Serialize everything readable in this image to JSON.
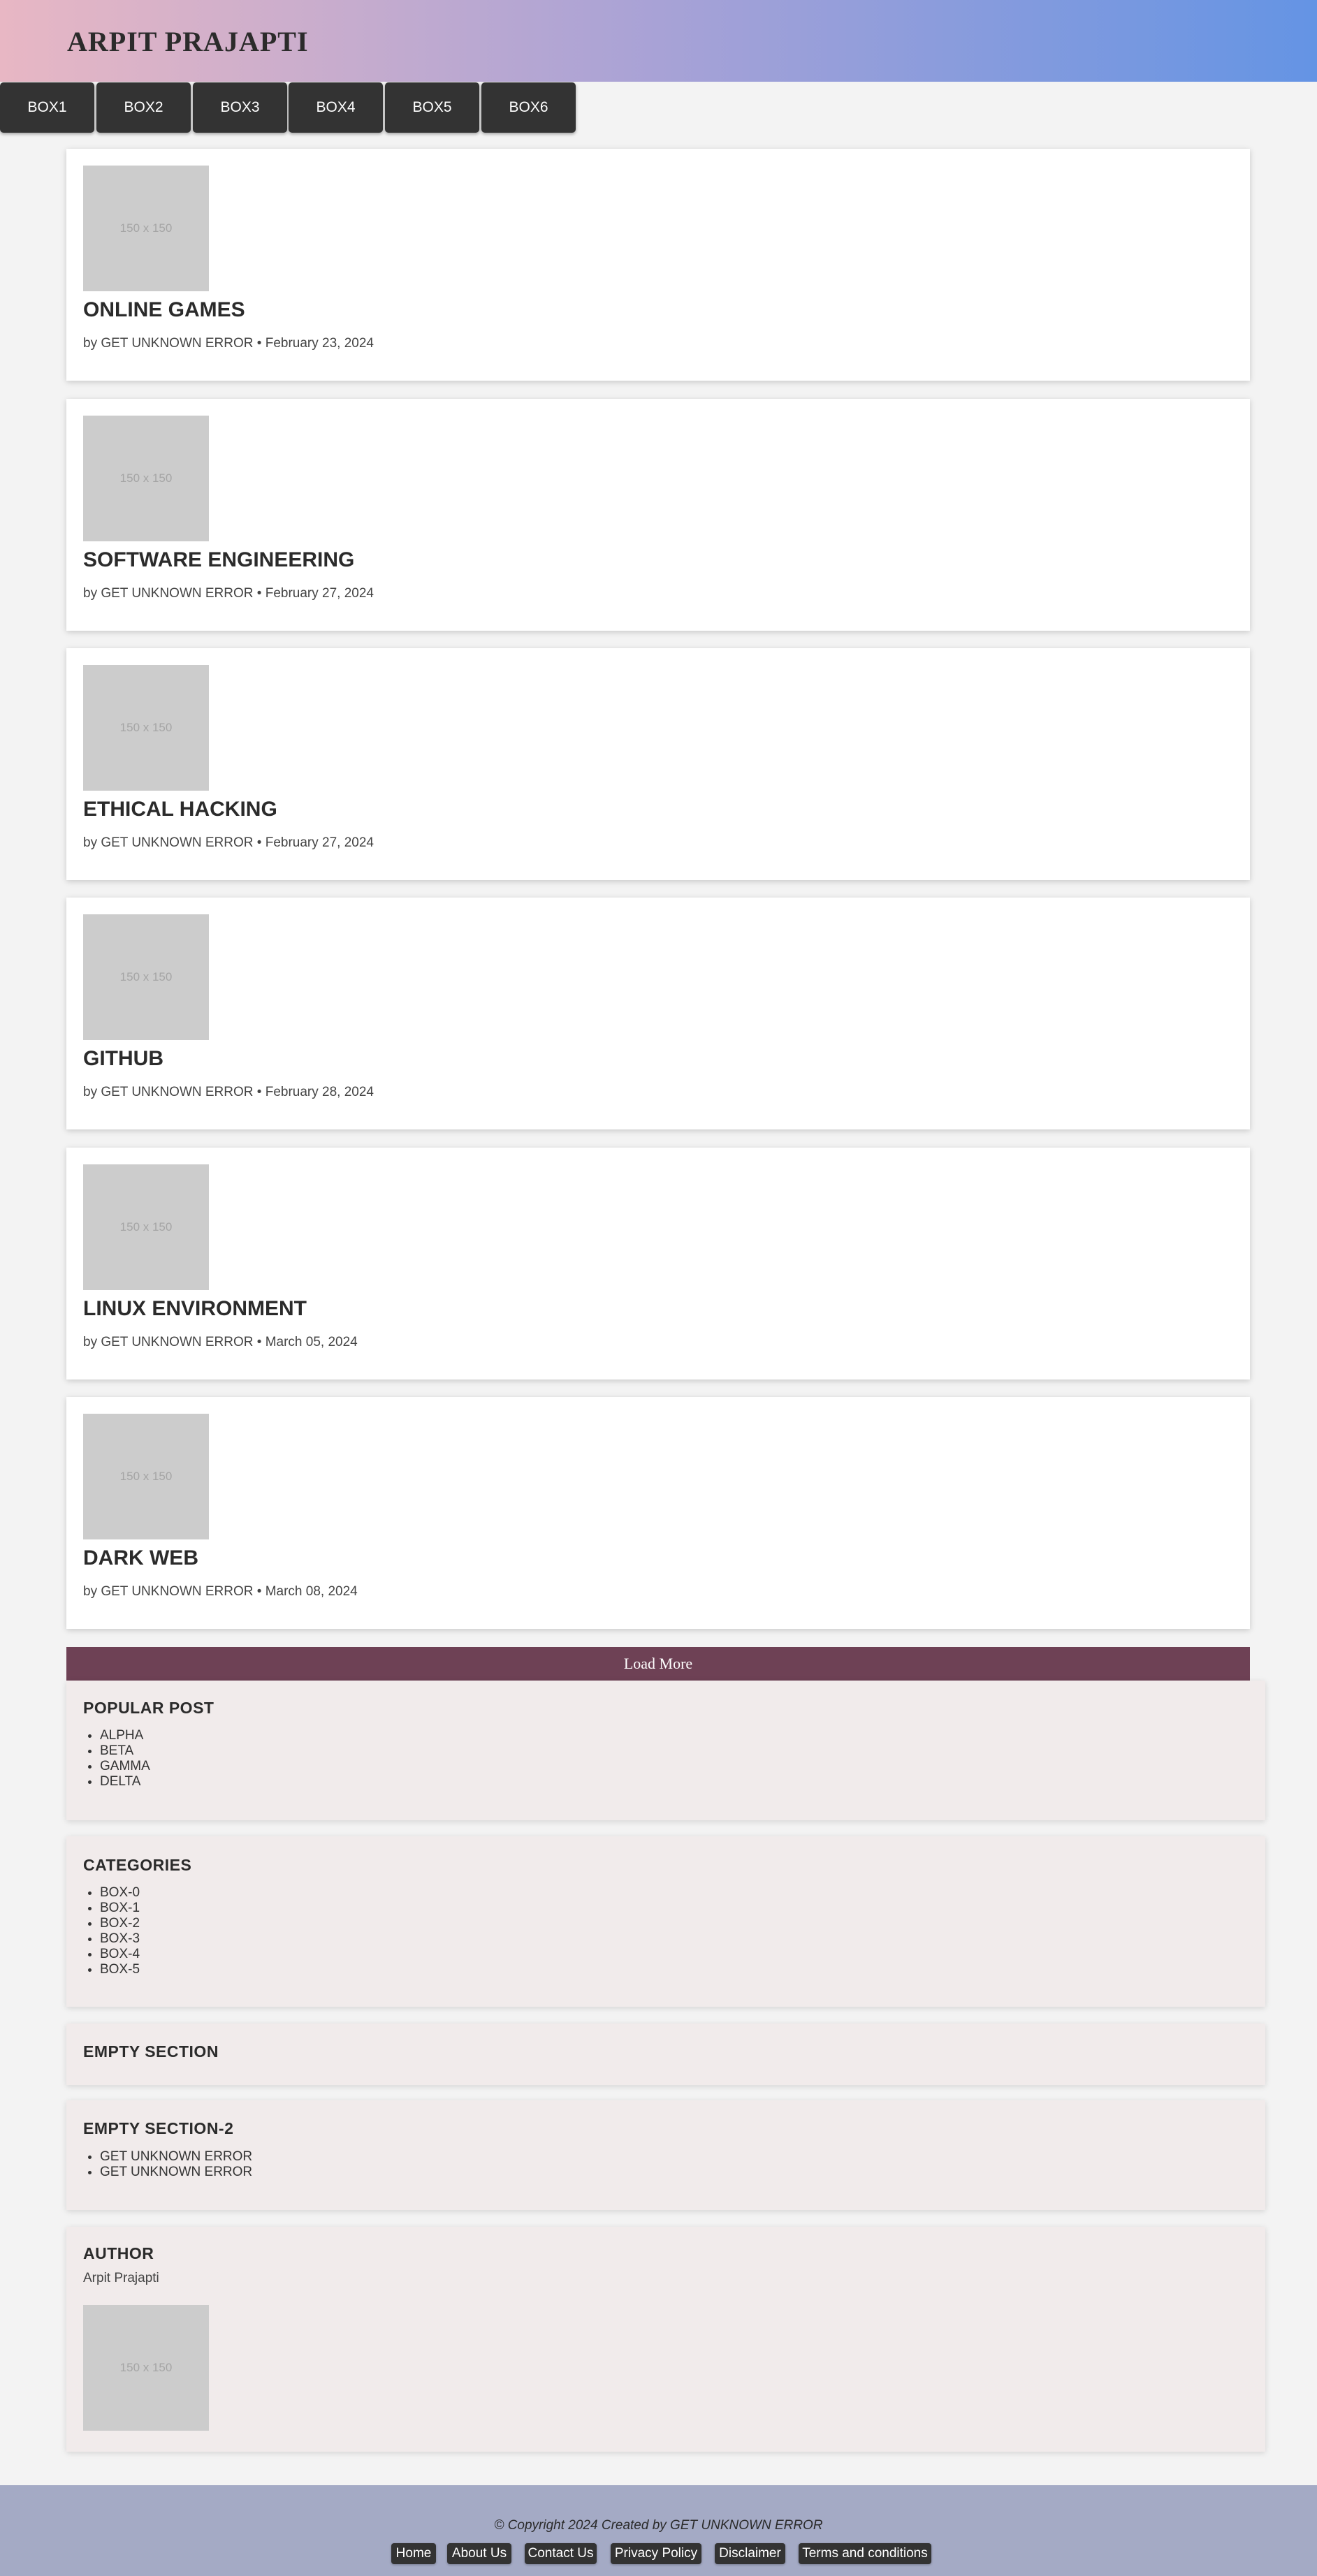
{
  "header": {
    "title": "ARPIT PRAJAPTI"
  },
  "nav": [
    "BOX1",
    "BOX2",
    "BOX3",
    "BOX4",
    "BOX5",
    "BOX6"
  ],
  "posts": [
    {
      "image": "150 x 150",
      "title": "ONLINE GAMES",
      "meta": "by GET UNKNOWN ERROR • February 23, 2024"
    },
    {
      "image": "150 x 150",
      "title": "SOFTWARE ENGINEERING",
      "meta": "by GET UNKNOWN ERROR • February 27, 2024"
    },
    {
      "image": "150 x 150",
      "title": "ETHICAL HACKING",
      "meta": "by GET UNKNOWN ERROR • February 27, 2024"
    },
    {
      "image": "150 x 150",
      "title": "GITHUB",
      "meta": "by GET UNKNOWN ERROR • February 28, 2024"
    },
    {
      "image": "150 x 150",
      "title": "LINUX ENVIRONMENT",
      "meta": "by GET UNKNOWN ERROR • March 05, 2024"
    },
    {
      "image": "150 x 150",
      "title": "DARK WEB",
      "meta": "by GET UNKNOWN ERROR • March 08, 2024"
    }
  ],
  "load_more": "Load More",
  "sidebar": {
    "popular": {
      "title": "POPULAR POST",
      "items": [
        "ALPHA",
        "BETA",
        "GAMMA",
        "DELTA"
      ]
    },
    "categories": {
      "title": "CATEGORIES",
      "items": [
        "BOX-0",
        "BOX-1",
        "BOX-2",
        "BOX-3",
        "BOX-4",
        "BOX-5"
      ]
    },
    "empty": {
      "title": "EMPTY SECTION"
    },
    "empty2": {
      "title": "EMPTY SECTION-2",
      "items": [
        "GET UNKNOWN ERROR",
        "GET UNKNOWN ERROR"
      ]
    },
    "author": {
      "title": "AUTHOR",
      "name": "Arpit Prajapti",
      "image": "150 x 150"
    }
  },
  "footer": {
    "copyright": "© Copyright 2024 Created by GET UNKNOWN ERROR",
    "links": [
      "Home",
      "About Us",
      "Contact Us",
      "Privacy Policy",
      "Disclaimer",
      "Terms and conditions"
    ]
  },
  "colors": {
    "header_gradient": [
      "#e8b7c4",
      "#a8a2d6",
      "#6494e4"
    ],
    "nav_button": "#333333",
    "load_more": "#6e4155",
    "widget_bg": "#f1ebeb",
    "footer_bg": "#a4aac5"
  }
}
